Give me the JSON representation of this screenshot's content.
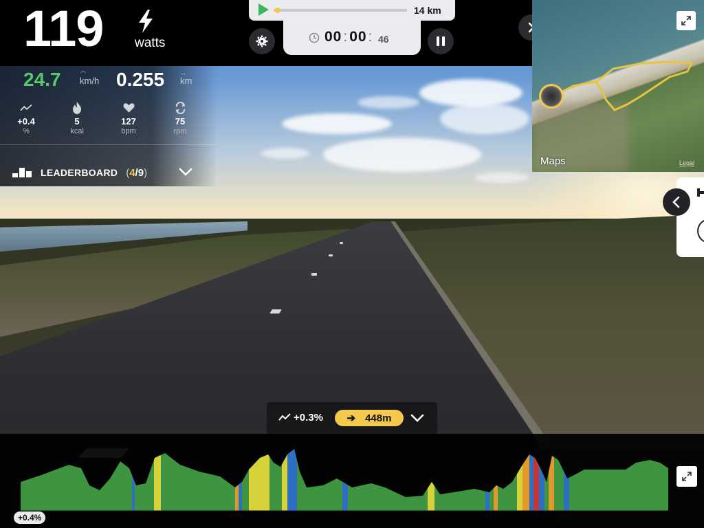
{
  "power": {
    "value": "119",
    "unit": "watts",
    "icon": "bolt-icon"
  },
  "speed": {
    "value": "24.7",
    "unit": "km/h",
    "color": "#59c76a"
  },
  "distance": {
    "value": "0.255",
    "unit": "km"
  },
  "metrics": [
    {
      "name": "gradient",
      "icon": "slope-icon",
      "value": "+0.4",
      "unit": "%"
    },
    {
      "name": "calories",
      "icon": "flame-icon",
      "value": "5",
      "unit": "kcal"
    },
    {
      "name": "heart-rate",
      "icon": "heart-icon",
      "value": "127",
      "unit": "bpm"
    },
    {
      "name": "cadence",
      "icon": "cycle-icon",
      "value": "75",
      "unit": "rpm"
    }
  ],
  "leaderboard": {
    "label": "LEADERBOARD",
    "open": "(",
    "position": "4",
    "separator": "/",
    "total": "9",
    "close": ")"
  },
  "route": {
    "length": "14 km",
    "progress_fraction": 0.03
  },
  "timer": {
    "hours": "00",
    "minutes": "00",
    "seconds": "46"
  },
  "map": {
    "label": "Maps",
    "legal": "Legal"
  },
  "segment": {
    "slope": "+0.3%",
    "next_distance": "448m"
  },
  "elevation": {
    "current_gradient": "+0.4%"
  },
  "colors": {
    "accent_yellow": "#f2c94c",
    "speed_green": "#59c76a",
    "elev_green": "#3e9440",
    "elev_yellow": "#d6d23a",
    "elev_orange": "#e09a2c",
    "elev_blue": "#2f6fc1",
    "elev_red": "#c23838"
  }
}
